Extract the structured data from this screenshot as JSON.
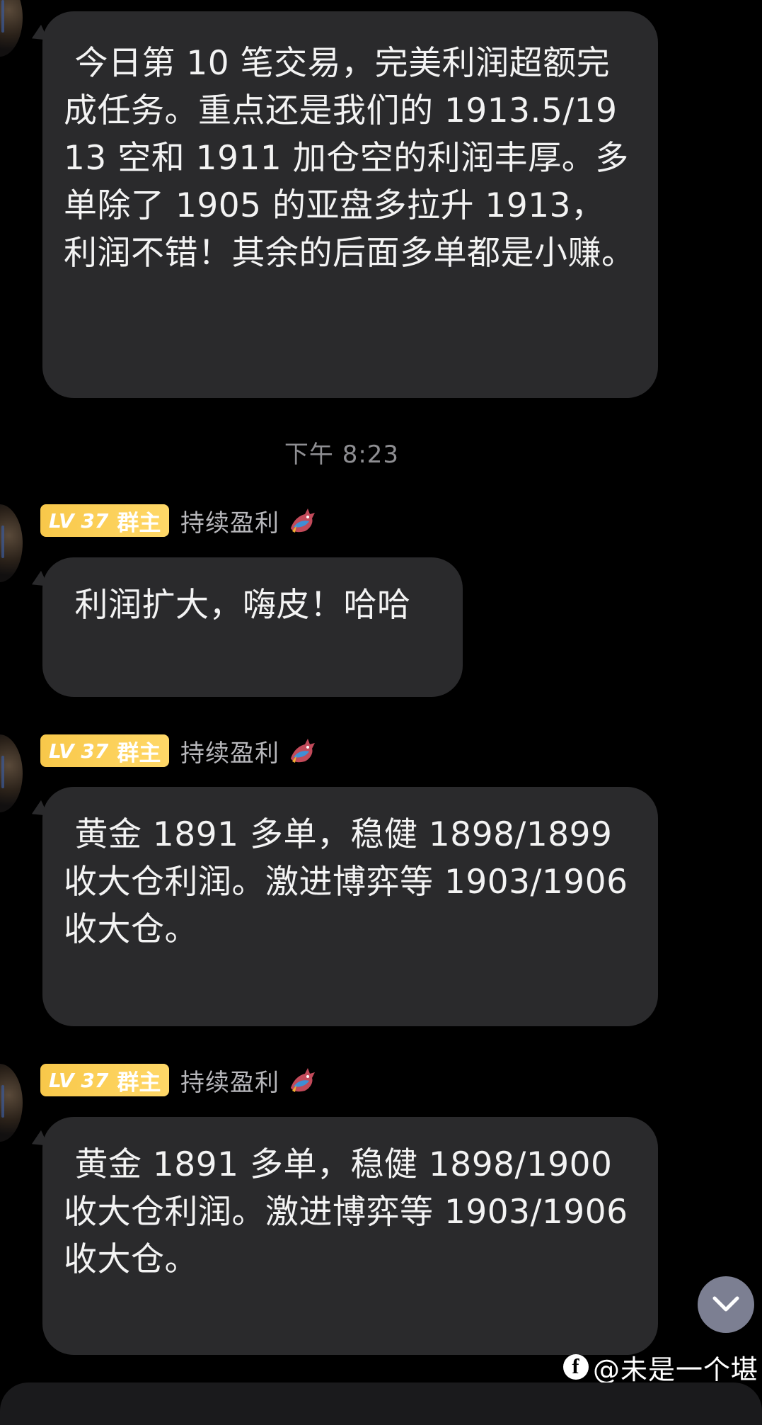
{
  "messages": [
    {
      "text": " 今日第 10 笔交易，完美利润超额完成任务。重点还是我们的 1913.5/1913 空和 1911 加仓空的利润丰厚。多单除了 1905 的亚盘多拉升 1913，利润不错！其余的后面多单都是小赚。"
    },
    {
      "level": "LV 37",
      "role": "群主",
      "sender": "持续盈利",
      "text": " 利润扩大，嗨皮！哈哈"
    },
    {
      "level": "LV 37",
      "role": "群主",
      "sender": "持续盈利",
      "text": " 黄金 1891 多单，稳健 1898/1899 收大仓利润。激进博弈等 1903/1906 收大仓。"
    },
    {
      "level": "LV 37",
      "role": "群主",
      "sender": "持续盈利",
      "text": " 黄金 1891 多单，稳健 1898/1900 收大仓利润。激进博弈等 1903/1906 收大仓。"
    }
  ],
  "timestamp": "下午 8:23",
  "watermark": "@未是一个堪",
  "icons": {
    "scroll": "chevron-down-icon",
    "badge": "dragon-icon",
    "watermark_logo": "facebook-icon"
  },
  "colors": {
    "background": "#000000",
    "bubble": "#2a2a2c",
    "badge": "#f8c84a",
    "timestamp": "#8e8e92",
    "scroll_button": "#7c7f92"
  }
}
